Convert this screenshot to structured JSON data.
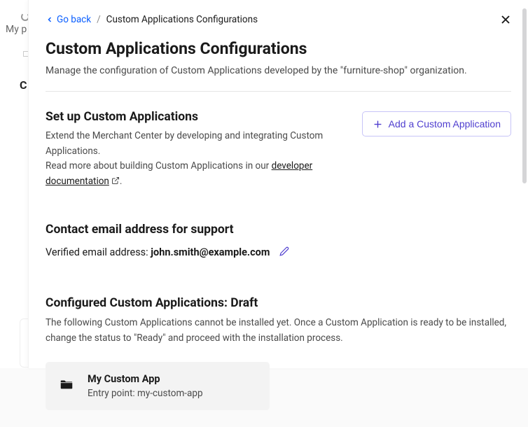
{
  "background": {
    "truncated_text": "My p",
    "letter": "C"
  },
  "breadcrumb": {
    "go_back_label": "Go back",
    "current": "Custom Applications Configurations"
  },
  "page": {
    "title": "Custom Applications Configurations",
    "subtitle": "Manage the configuration of Custom Applications developed by the \"furniture-shop\" organization."
  },
  "setup": {
    "heading": "Set up Custom Applications",
    "desc_line1": "Extend the Merchant Center by developing and integrating Custom Applications.",
    "desc_prefix": "Read more about building Custom Applications in our ",
    "doc_link_label": "developer documentation",
    "desc_suffix": ".",
    "add_button_label": "Add a Custom Application"
  },
  "contact": {
    "heading": "Contact email address for support",
    "label": "Verified email address: ",
    "email": "john.smith@example.com"
  },
  "configured": {
    "heading": "Configured Custom Applications: Draft",
    "desc": "The following Custom Applications cannot be installed yet. Once a Custom Application is ready to be installed, change the status to \"Ready\" and proceed with the installation process.",
    "app": {
      "name": "My Custom App",
      "entry_prefix": "Entry point: ",
      "entry_value": "my-custom-app"
    }
  }
}
